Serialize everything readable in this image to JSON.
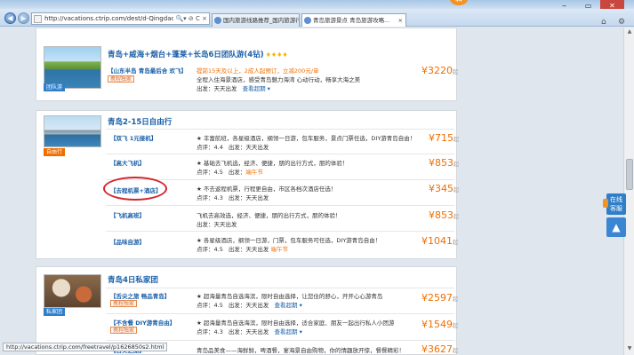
{
  "browser": {
    "url": "http://vacations.ctrip.com/dest/d-Qingdao-5",
    "tabs": [
      {
        "label": "国内旅游线路推荐_国内旅游行..."
      },
      {
        "label": "青岛旅游景点 青岛旅游攻略..."
      }
    ],
    "notification_count": "44",
    "status_url": "http://vacations.ctrip.com/freetravel/p1626850s2.html"
  },
  "products": [
    {
      "title": "青岛+威海+烟台+蓬莱+长岛6日团队游(4钻)",
      "diamonds": "♦♦♦♦",
      "image_tag": "团队游",
      "subtitle": "【山东半岛 青岛最后合 欢飞】",
      "promo_tag": "携程独家",
      "line1": "提前15天及以上，2成人起预订，立减200元/单",
      "line2": "全程入住海景酒店，感受青岛魅力海湾 心动行动，畅享大海之美",
      "line3": "天天出发",
      "line3_label": "出发：",
      "expand": "查看超期 ▾",
      "price": "3220",
      "price_suffix": "起"
    },
    {
      "title": "青岛2-15日自由行",
      "image_tag": "自由行",
      "options": [
        {
          "name": "【双飞 1元接机】",
          "desc": "丰富航班，各星级酒店，纲领一日游，包车服务，景点门票任选，DIY游青岛自由！",
          "score": "点评：4.4",
          "departure": "天天出发",
          "extra": "",
          "price": "715"
        },
        {
          "name": "【高大飞机】",
          "desc": "基础去飞机选，经济、便捷，朋的出行方式，朋的体验！",
          "score": "点评：4.5",
          "departure": "",
          "extra": "端午节",
          "price": "853"
        },
        {
          "name": "【去程机票+酒店】",
          "desc": "不去返程机票，行程更自由，市区各档次酒店任选！",
          "score": "点评：4.3",
          "departure": "天天出发",
          "extra": "",
          "price": "345"
        },
        {
          "name": "【飞机高班】",
          "desc": "飞机去高效选，经济、便捷，朋的出行方式，朋的体验！",
          "score": "",
          "departure": "天天出发",
          "extra": "",
          "price": "853"
        },
        {
          "name": "【品味自游】",
          "desc": "各星级酒店，纲领一日游，门票，包车服务可任选，DIY游青岛自由！",
          "score": "点评：4.5",
          "departure": "天天出发",
          "extra": "端午节",
          "price": "1041"
        }
      ],
      "price_suffix": "起",
      "score_extra": "端午节",
      "departure_label": "出发："
    },
    {
      "title": "青岛4日私家团",
      "image_tag": "私家团",
      "options": [
        {
          "name": "【舌尖之旅 畅品青岛】",
          "promo": "携程独家",
          "desc": "超海量青岛自选海滨，限时自由选择，让您住的舒心，开开心心游青岛",
          "score": "点评：4.5",
          "departure": "天天出发",
          "expand": "查看超期 ▾",
          "price": "2597"
        },
        {
          "name": "【不含餐 DIY游青自由】",
          "promo": "携程独家",
          "desc": "超海量青岛自选海滨，限时自由选择，适合家庭、朋友一起出行私人小团游",
          "score": "点评：4.3",
          "departure": "天天出发",
          "expand": "查看超期 ▾",
          "price": "1549"
        },
        {
          "name": "【舌尖之旅】",
          "desc": "青岛品美食——海鲜鲜，啤酒餐，宴海景自由购物，你的情趣放开惊，餐餐精彩！",
          "price": "3627"
        }
      ],
      "price_suffix": "起"
    }
  ],
  "sidebar": {
    "online_label_1": "在线",
    "online_label_2": "客服",
    "to_top": "▲"
  },
  "colors": {
    "accent": "#1a5fa8",
    "price": "#f06e00",
    "circle": "#d2262d"
  }
}
